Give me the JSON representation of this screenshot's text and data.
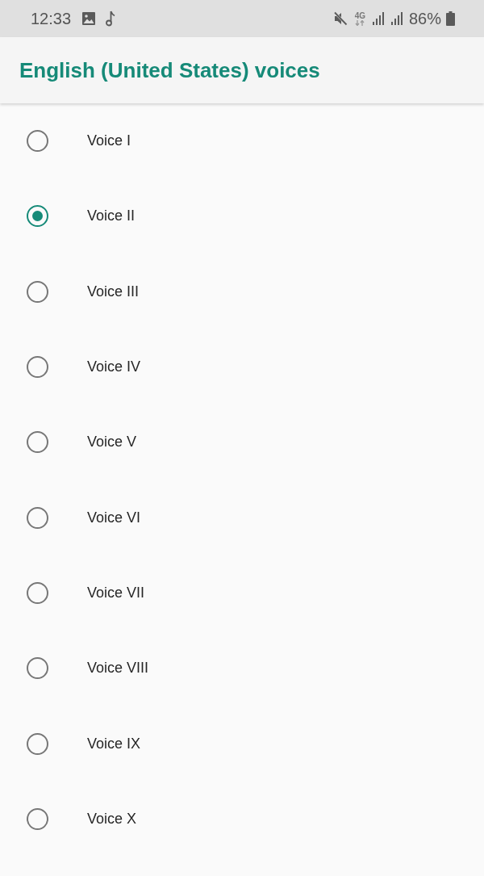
{
  "status_bar": {
    "time": "12:33",
    "network": "4G",
    "battery": "86%"
  },
  "app_bar": {
    "title": "English (United States) voices"
  },
  "voices": [
    {
      "label": "Voice I",
      "selected": false
    },
    {
      "label": "Voice II",
      "selected": true
    },
    {
      "label": "Voice III",
      "selected": false
    },
    {
      "label": "Voice IV",
      "selected": false
    },
    {
      "label": "Voice V",
      "selected": false
    },
    {
      "label": "Voice VI",
      "selected": false
    },
    {
      "label": "Voice VII",
      "selected": false
    },
    {
      "label": "Voice VIII",
      "selected": false
    },
    {
      "label": "Voice IX",
      "selected": false
    },
    {
      "label": "Voice X",
      "selected": false
    }
  ]
}
